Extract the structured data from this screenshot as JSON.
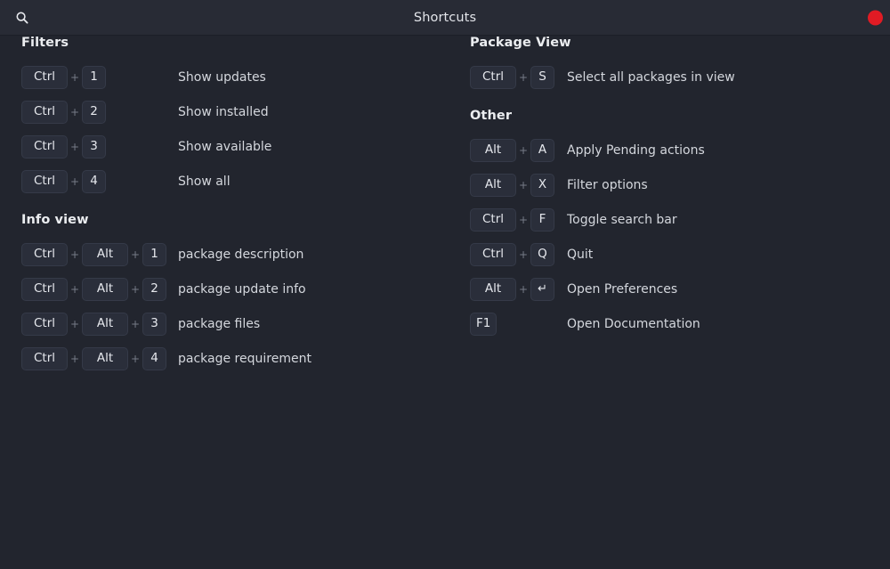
{
  "window": {
    "title": "Shortcuts",
    "search_icon": "search-icon",
    "close_button_color": "#e01b24",
    "close_icon": "close-icon"
  },
  "theme": {
    "background": "#22252e",
    "titlebar_background": "#282b35",
    "key_background": "#2a2e3a",
    "key_border": "#353a48",
    "text": "#d4d7dd",
    "heading": "#ebedf0",
    "plus": "#767b87",
    "accent_close": "#e01b24"
  },
  "separator": "+",
  "columns": {
    "left": [
      {
        "title": "Filters",
        "shortcuts": [
          {
            "keys": [
              "Ctrl",
              "1"
            ],
            "action": "Show updates"
          },
          {
            "keys": [
              "Ctrl",
              "2"
            ],
            "action": "Show installed"
          },
          {
            "keys": [
              "Ctrl",
              "3"
            ],
            "action": "Show available"
          },
          {
            "keys": [
              "Ctrl",
              "4"
            ],
            "action": "Show all"
          }
        ]
      },
      {
        "title": "Info view",
        "shortcuts": [
          {
            "keys": [
              "Ctrl",
              "Alt",
              "1"
            ],
            "action": "package description"
          },
          {
            "keys": [
              "Ctrl",
              "Alt",
              "2"
            ],
            "action": "package update info"
          },
          {
            "keys": [
              "Ctrl",
              "Alt",
              "3"
            ],
            "action": "package files"
          },
          {
            "keys": [
              "Ctrl",
              "Alt",
              "4"
            ],
            "action": "package requirement"
          }
        ]
      }
    ],
    "right": [
      {
        "title": "Package View",
        "shortcuts": [
          {
            "keys": [
              "Ctrl",
              "S"
            ],
            "action": "Select all packages in view"
          }
        ]
      },
      {
        "title": "Other",
        "shortcuts": [
          {
            "keys": [
              "Alt",
              "A"
            ],
            "action": "Apply Pending actions"
          },
          {
            "keys": [
              "Alt",
              "X"
            ],
            "action": "Filter options"
          },
          {
            "keys": [
              "Ctrl",
              "F"
            ],
            "action": "Toggle search bar"
          },
          {
            "keys": [
              "Ctrl",
              "Q"
            ],
            "action": "Quit"
          },
          {
            "keys": [
              "Alt",
              "↵"
            ],
            "action": "Open Preferences"
          },
          {
            "keys": [
              "F1"
            ],
            "action": "Open Documentation"
          }
        ]
      }
    ]
  }
}
